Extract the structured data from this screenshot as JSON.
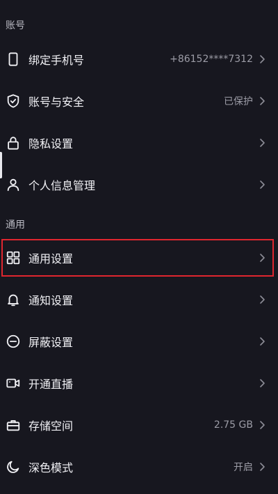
{
  "sections": {
    "account": "账号",
    "general": "通用"
  },
  "rows": {
    "bind_phone": {
      "label": "绑定手机号",
      "value": "+86152****7312",
      "icon": "phone-icon"
    },
    "account_security": {
      "label": "账号与安全",
      "value": "已保护",
      "icon": "shield-check-icon"
    },
    "privacy": {
      "label": "隐私设置",
      "value": "",
      "icon": "lock-icon"
    },
    "personal_info": {
      "label": "个人信息管理",
      "value": "",
      "icon": "user-icon"
    },
    "general_settings": {
      "label": "通用设置",
      "value": "",
      "icon": "grid-icon"
    },
    "notifications": {
      "label": "通知设置",
      "value": "",
      "icon": "bell-icon"
    },
    "block": {
      "label": "屏蔽设置",
      "value": "",
      "icon": "minus-circle-icon"
    },
    "live": {
      "label": "开通直播",
      "value": "",
      "icon": "video-camera-icon"
    },
    "storage": {
      "label": "存储空间",
      "value": "2.75 GB",
      "icon": "briefcase-icon"
    },
    "dark_mode": {
      "label": "深色模式",
      "value": "开启",
      "icon": "moon-icon"
    }
  },
  "colors": {
    "background": "#17171f",
    "text": "#f1f1f5",
    "muted": "#9c9ca6",
    "highlight": "#e0262f"
  }
}
